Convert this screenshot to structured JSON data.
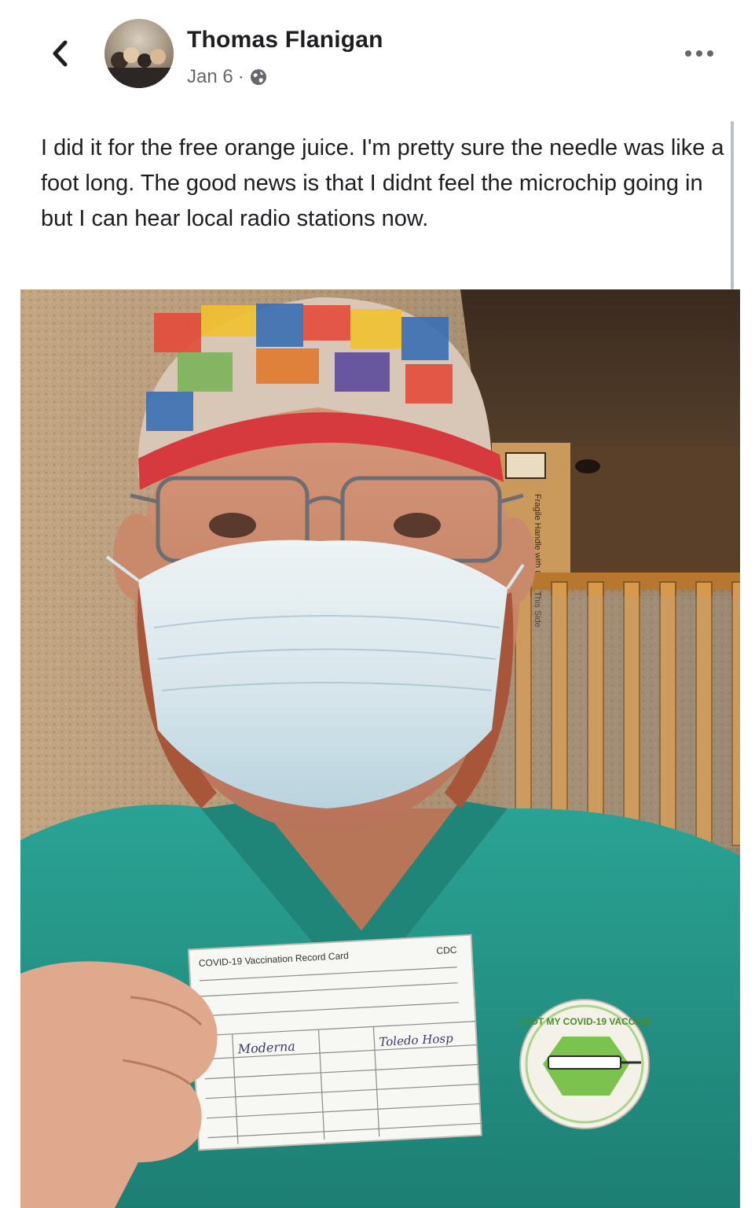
{
  "post": {
    "author": "Thomas Flanigan",
    "date": "Jan 6",
    "separator": "·",
    "privacy_icon": "globe-icon",
    "text": "I did it for the free orange juice. I'm pretty sure the needle was like a foot long. The good news is that I didnt feel the microchip going in but I can hear local radio stations now."
  },
  "nav": {
    "back_icon": "chevron-left-icon",
    "more_icon": "more-horizontal-icon"
  },
  "photo": {
    "card_title": "COVID-19 Vaccination Record Card",
    "card_logo": "CDC",
    "card_vaccine": "Moderna",
    "card_site": "Toledo Hosp",
    "sticker_text": "I GOT MY COVID-19 VACCINE",
    "box_label": "Fragile Handle with Care This Side"
  },
  "colors": {
    "scrub_teal": "#2f9e8f",
    "mask_blue": "#cfe3ec",
    "sticker_green": "#7cc24e",
    "wall_beige": "#c9a985",
    "rail_wood": "#c98a3e"
  }
}
